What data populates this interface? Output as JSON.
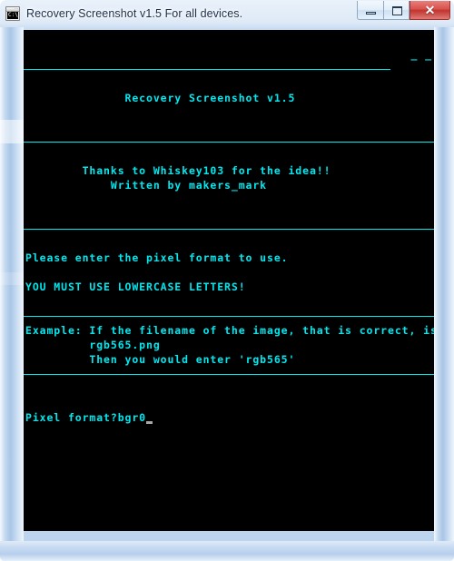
{
  "window": {
    "title": "Recovery Screenshot v1.5 For all devices.",
    "icon": "console-icon",
    "icon_text": "C:\\",
    "controls": {
      "minimize_label": "–",
      "maximize_label": "□",
      "close_label": "✕"
    }
  },
  "console": {
    "background_color": "#000000",
    "text_color": "#00e8f0",
    "cursor_color": "#a8a8a8",
    "lines": [
      {
        "type": "text",
        "text": ""
      },
      {
        "type": "dashes",
        "text": "_ _"
      },
      {
        "type": "rule",
        "text": ""
      },
      {
        "type": "text",
        "text": ""
      },
      {
        "type": "text",
        "text": "              Recovery Screenshot v1.5"
      },
      {
        "type": "text",
        "text": ""
      },
      {
        "type": "text",
        "text": ""
      },
      {
        "type": "rule",
        "text": ""
      },
      {
        "type": "text",
        "text": ""
      },
      {
        "type": "text",
        "text": "        Thanks to Whiskey103 for the idea!!"
      },
      {
        "type": "text",
        "text": "            Written by makers_mark"
      },
      {
        "type": "text",
        "text": ""
      },
      {
        "type": "text",
        "text": ""
      },
      {
        "type": "rule",
        "text": ""
      },
      {
        "type": "text",
        "text": ""
      },
      {
        "type": "text",
        "text": "Please enter the pixel format to use."
      },
      {
        "type": "text",
        "text": ""
      },
      {
        "type": "text",
        "text": "YOU MUST USE LOWERCASE LETTERS!"
      },
      {
        "type": "text",
        "text": ""
      },
      {
        "type": "rule",
        "text": ""
      },
      {
        "type": "text",
        "text": "Example: If the filename of the image, that is correct, is"
      },
      {
        "type": "text",
        "text": "         rgb565.png"
      },
      {
        "type": "text",
        "text": "         Then you would enter 'rgb565'"
      },
      {
        "type": "rule",
        "text": ""
      },
      {
        "type": "text",
        "text": ""
      },
      {
        "type": "text",
        "text": ""
      },
      {
        "type": "prompt",
        "text": "Pixel format?bgr0"
      }
    ]
  }
}
